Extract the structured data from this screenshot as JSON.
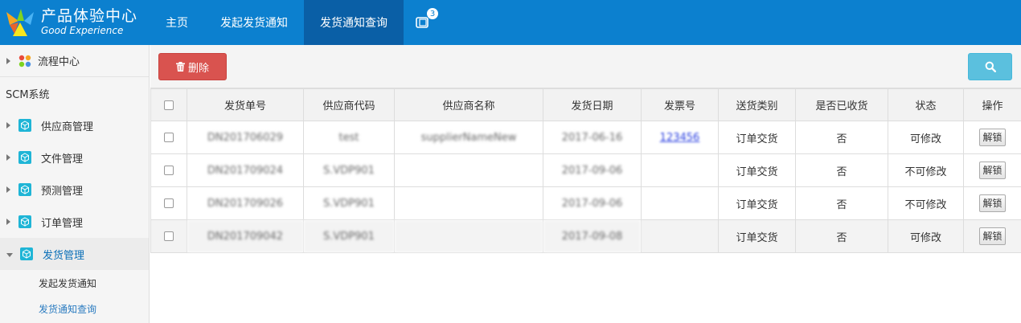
{
  "app": {
    "logo_cn": "产品体验中心",
    "logo_en": "Good Experience",
    "brand_color": "#0c80cf"
  },
  "nav": {
    "items": [
      {
        "label": "主页",
        "active": false
      },
      {
        "label": "发起发货通知",
        "active": false
      },
      {
        "label": "发货通知查询",
        "active": true
      }
    ],
    "message_badge": "3"
  },
  "sidebar": {
    "flow_center": "流程中心",
    "section_title": "SCM系统",
    "items": [
      {
        "label": "供应商管理",
        "expanded": false
      },
      {
        "label": "文件管理",
        "expanded": false
      },
      {
        "label": "预测管理",
        "expanded": false
      },
      {
        "label": "订单管理",
        "expanded": false
      },
      {
        "label": "发货管理",
        "expanded": true
      }
    ],
    "sub_items": [
      {
        "label": "发起发货通知",
        "active": false
      },
      {
        "label": "发货通知查询",
        "active": true
      }
    ]
  },
  "toolbar": {
    "delete_label": "删除",
    "delete_color": "#d9534f",
    "search_color": "#5bc0de"
  },
  "table": {
    "headers": [
      "发货单号",
      "供应商代码",
      "供应商名称",
      "发货日期",
      "发票号",
      "送货类别",
      "是否已收货",
      "状态",
      "操作"
    ],
    "rows": [
      {
        "shipment_no": "DN201706029",
        "supplier_code": "test",
        "supplier_name": "supplierNameNew",
        "ship_date": "2017-06-16",
        "invoice_no": "123456",
        "delivery_type": "订单交货",
        "received": "否",
        "status": "可修改",
        "action": "解锁"
      },
      {
        "shipment_no": "DN201709024",
        "supplier_code": "S.VDP901",
        "supplier_name": "",
        "ship_date": "2017-09-06",
        "invoice_no": "",
        "delivery_type": "订单交货",
        "received": "否",
        "status": "不可修改",
        "action": "解锁"
      },
      {
        "shipment_no": "DN201709026",
        "supplier_code": "S.VDP901",
        "supplier_name": "",
        "ship_date": "2017-09-06",
        "invoice_no": "",
        "delivery_type": "订单交货",
        "received": "否",
        "status": "不可修改",
        "action": "解锁"
      },
      {
        "shipment_no": "DN201709042",
        "supplier_code": "S.VDP901",
        "supplier_name": "",
        "ship_date": "2017-09-08",
        "invoice_no": "",
        "delivery_type": "订单交货",
        "received": "否",
        "status": "可修改",
        "action": "解锁"
      }
    ]
  }
}
